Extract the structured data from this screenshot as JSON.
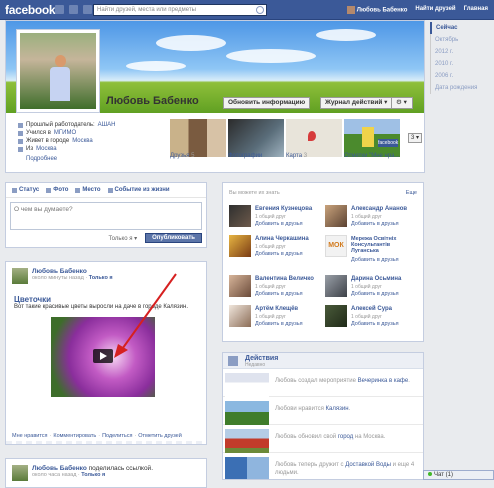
{
  "topbar": {
    "logo": "facebook",
    "search_placeholder": "Найти друзей, места или предметы",
    "user_name": "Любовь Бабенко",
    "find_friends": "Найти друзей",
    "home": "Главная"
  },
  "timeline_nav": [
    "Сейчас",
    "Октябрь",
    "2012 г.",
    "2010 г.",
    "2006 г.",
    "Дата рождения"
  ],
  "profile": {
    "name": "Любовь Бабенко",
    "update_info": "Обновить информацию",
    "activity_log": "Журнал действий",
    "info": [
      {
        "label": "Прошлый работодатель: ",
        "link": "АШАН"
      },
      {
        "label": "Учился в ",
        "link": "МГИМО"
      },
      {
        "label": "Живет в городе ",
        "link": "Москва"
      },
      {
        "label": "Из ",
        "link": "Москва"
      }
    ],
    "more": "Подробнее",
    "tiles": [
      {
        "label": "Друзья",
        "count": "5"
      },
      {
        "label": "Фотографии",
        "count": ""
      },
      {
        "label": "Карта",
        "count": "3"
      },
      {
        "label": "Отметки \"Мне нра...",
        "count": ""
      }
    ],
    "tiles_more": "3 ▾"
  },
  "composer": {
    "tabs": [
      "Статус",
      "Фото",
      "Место",
      "Событие из жизни"
    ],
    "placeholder": "О чем вы думаете?",
    "privacy": "Только я ▾",
    "publish": "Опубликовать"
  },
  "post1": {
    "author": "Любовь Бабенко",
    "meta": "около минуты назад · ",
    "privacy": "Только я",
    "title": "Цветочки",
    "text_before": "Вот такие красивые цветы выросли на даче ",
    "text_red": "",
    "text_after": " в городе Калязин.",
    "actions": [
      "Мне нравится",
      "Комментировать",
      "Поделиться",
      "Отметить друзей"
    ]
  },
  "post2": {
    "author": "Любовь Бабенко",
    "shared": " поделилась ссылкой.",
    "meta": "около часа назад · ",
    "privacy": "Только я"
  },
  "suggestions": {
    "title": "Вы можете их знать",
    "all": "Еще",
    "add_label": "Добавить в друзья",
    "items": [
      {
        "name": "Евгения Кузнецова",
        "mutual": "1 общий друг"
      },
      {
        "name": "Александр Ананов",
        "mutual": "1 общий друг"
      },
      {
        "name": "Алина Черкашина",
        "mutual": "1 общий друг"
      },
      {
        "name": "Мережа Освітніх Консультантів Луганська",
        "mutual": ""
      },
      {
        "name": "Валентина Величко",
        "mutual": "1 общий друг"
      },
      {
        "name": "Дарина Осьмина",
        "mutual": "1 общий друг"
      },
      {
        "name": "Артём Клещёв",
        "mutual": "1 общий друг"
      },
      {
        "name": "Алексей Сура",
        "mutual": "1 общий друг"
      }
    ]
  },
  "activity": {
    "title": "Действия",
    "subtitle": "Недавно",
    "rows": [
      {
        "text_before": "Любовь создал мероприятие ",
        "link": "Вечеринка в кафе",
        "text_after": "."
      },
      {
        "text_before": "Любови нравится ",
        "link": "Калязин",
        "text_after": "."
      },
      {
        "text_before": "Любовь обновил свой ",
        "link": "город",
        "text_after": " на Москва."
      },
      {
        "text_before": "Любовь теперь дружит с ",
        "link": "Доставкой Воды",
        "text_after": " и еще 4 людьми."
      }
    ]
  },
  "chat": {
    "label": "Чат (1)"
  }
}
